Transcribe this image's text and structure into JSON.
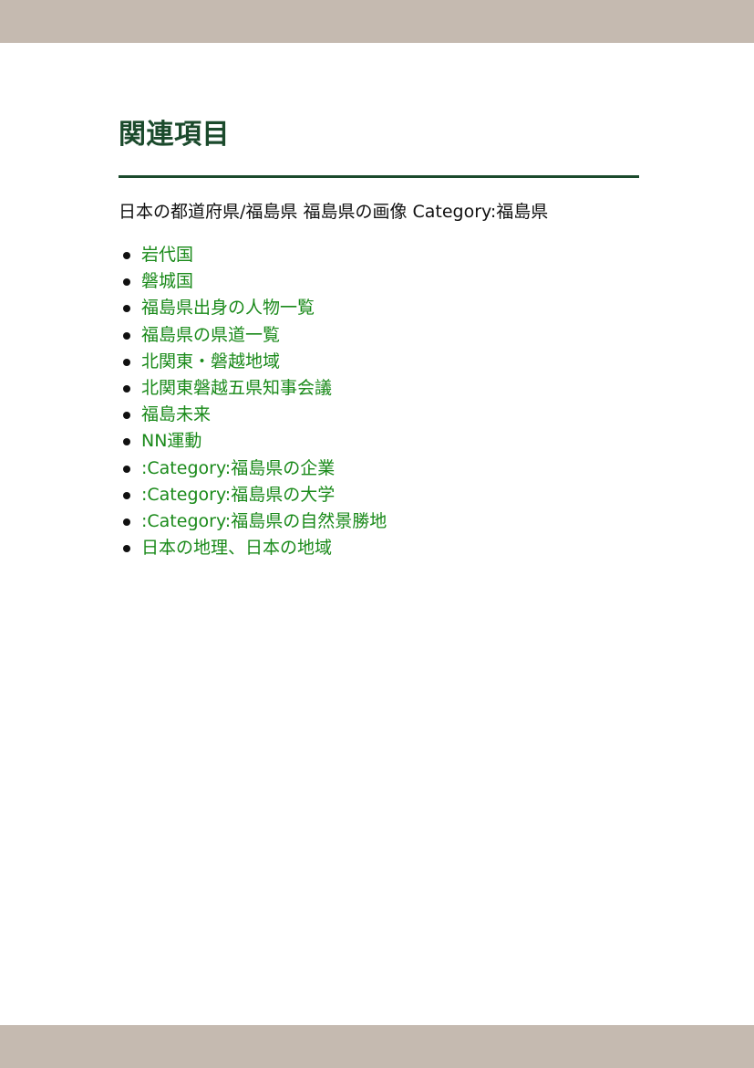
{
  "colors": {
    "band": "#c5bab0",
    "heading": "#1b4a2c",
    "link": "#1a8a1a",
    "text": "#111111"
  },
  "section": {
    "title": "関連項目",
    "see_also_text": "日本の都道府県/福島県 福島県の画像 Category:福島県"
  },
  "related_links": [
    "岩代国",
    "磐城国",
    "福島県出身の人物一覧",
    "福島県の県道一覧",
    "北関東・磐越地域",
    "北関東磐越五県知事会議",
    "福島未来",
    "NN運動",
    ":Category:福島県の企業",
    ":Category:福島県の大学",
    ":Category:福島県の自然景勝地",
    "日本の地理、日本の地域"
  ]
}
